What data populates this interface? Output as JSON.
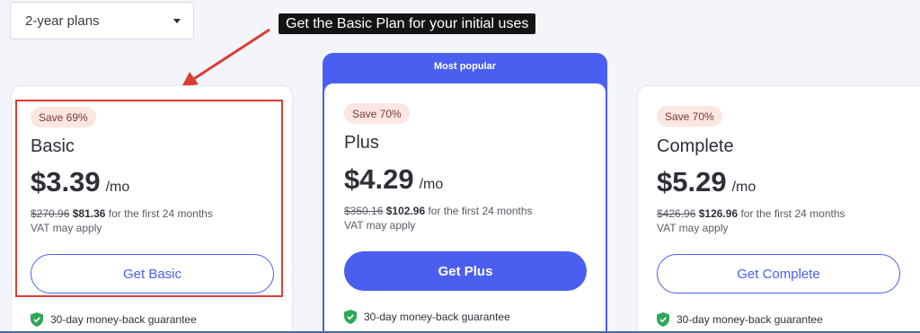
{
  "period_select": {
    "value": "2-year plans",
    "icon": "caret-down-icon"
  },
  "annotation": {
    "text": "Get the Basic Plan for your initial uses",
    "arrow_color": "#d93e36"
  },
  "popular_label": "Most popular",
  "colors": {
    "accent": "#4a5ff0",
    "badge_bg": "#fbe6e2",
    "highlight": "#d93e36",
    "shield": "#2ea85a"
  },
  "plans": [
    {
      "badge": "Save 69%",
      "name": "Basic",
      "price": "$3.39",
      "per": "/mo",
      "old_price": "$270.96",
      "new_price": "$81.36",
      "term": " for the first 24 months",
      "vat": "VAT may apply",
      "button": "Get Basic",
      "guarantee": "30-day money-back guarantee"
    },
    {
      "badge": "Save 70%",
      "name": "Plus",
      "price": "$4.29",
      "per": "/mo",
      "old_price": "$350.16",
      "new_price": "$102.96",
      "term": " for the first 24 months",
      "vat": "VAT may apply",
      "button": "Get Plus",
      "guarantee": "30-day money-back guarantee"
    },
    {
      "badge": "Save 70%",
      "name": "Complete",
      "price": "$5.29",
      "per": "/mo",
      "old_price": "$426.96",
      "new_price": "$126.96",
      "term": " for the first 24 months",
      "vat": "VAT may apply",
      "button": "Get Complete",
      "guarantee": "30-day money-back guarantee"
    }
  ]
}
